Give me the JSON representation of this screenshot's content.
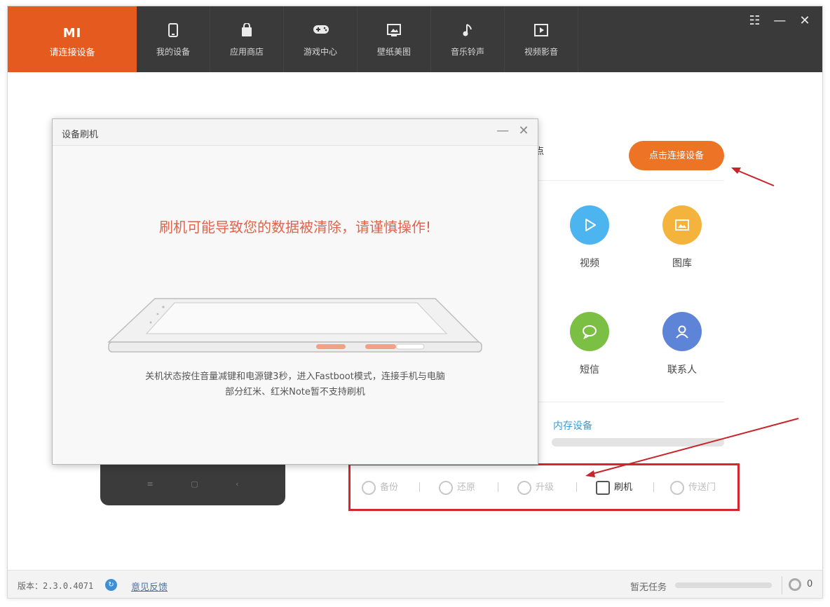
{
  "brand": {
    "logo": "MI",
    "label": "请连接设备",
    "color": "#e55a1f"
  },
  "nav": [
    {
      "label": "我的设备",
      "icon": "phone-icon"
    },
    {
      "label": "应用商店",
      "icon": "bag-icon"
    },
    {
      "label": "游戏中心",
      "icon": "gamepad-icon"
    },
    {
      "label": "壁纸美图",
      "icon": "picture-icon"
    },
    {
      "label": "音乐铃声",
      "icon": "music-icon"
    },
    {
      "label": "视频影音",
      "icon": "video-icon"
    }
  ],
  "window_controls": {
    "menu": "☷",
    "minimize": "—",
    "close": "✕"
  },
  "right": {
    "partial_text": "点",
    "connect_button": "点击连接设备",
    "functions": [
      {
        "name": "视频",
        "icon": "play-icon",
        "color": "#4cb4ef"
      },
      {
        "name": "图库",
        "icon": "image-icon",
        "color": "#f3b33d"
      },
      {
        "name": "短信",
        "icon": "message-icon",
        "color": "#7bbf45"
      },
      {
        "name": "联系人",
        "icon": "contact-icon",
        "color": "#5d84d6"
      }
    ],
    "storage_label": "内存设备"
  },
  "actions": [
    {
      "label": "备份",
      "icon": "backup-icon"
    },
    {
      "label": "还原",
      "icon": "restore-icon"
    },
    {
      "label": "升级",
      "icon": "upgrade-icon"
    },
    {
      "label": "刷机",
      "icon": "flash-icon"
    },
    {
      "label": "传送门",
      "icon": "send-icon"
    }
  ],
  "dialog": {
    "title": "设备刷机",
    "warning": "刷机可能导致您的数据被清除，请谨慎操作!",
    "hint_line1": "关机状态按住音量减键和电源键3秒，进入Fastboot模式，连接手机与电脑",
    "hint_line2": "部分红米、红米Note暂不支持刷机",
    "minimize": "—",
    "close": "✕"
  },
  "phone_keys": "≡ ▢ ‹",
  "status": {
    "version": "版本：2.3.0.4071",
    "feedback": "意见反馈",
    "task_label": "暂无任务",
    "task_count": "0"
  },
  "colors": {
    "accent": "#ec7424",
    "highlight_box": "#d4262b",
    "topbar": "#3a3a3a"
  }
}
